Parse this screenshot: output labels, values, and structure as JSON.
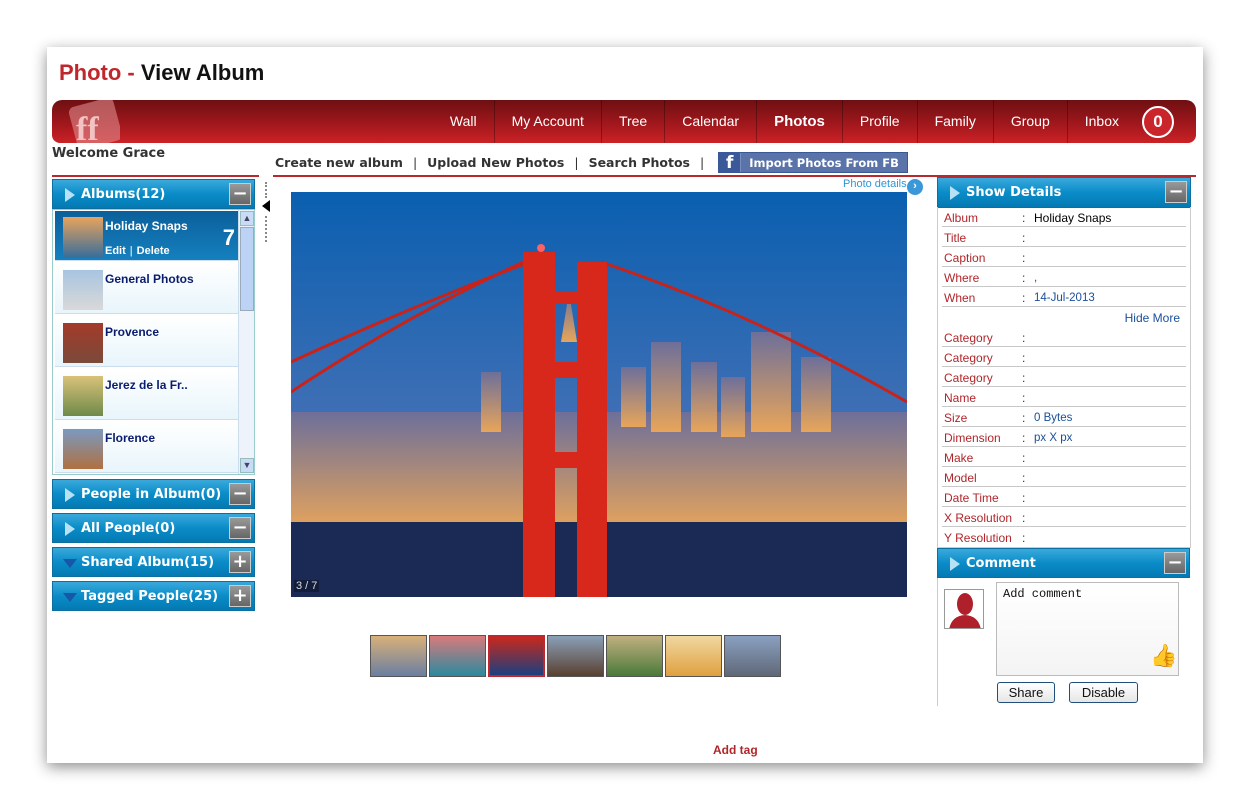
{
  "page": {
    "title_prefix": "Photo -",
    "title": "View Album"
  },
  "nav": {
    "items": [
      "Wall",
      "My Account",
      "Tree",
      "Calendar",
      "Photos",
      "Profile",
      "Family",
      "Group",
      "Inbox"
    ],
    "active": "Photos",
    "inbox_count": "0",
    "brand_color": "#c0272d"
  },
  "welcome": "Welcome Grace",
  "actions": {
    "create": "Create new album",
    "upload": "Upload New Photos",
    "search": "Search Photos",
    "sep": "|",
    "fb": "Import Photos From FB",
    "fb_icon": "f"
  },
  "left": {
    "albums_header": "Albums(12)",
    "albums": [
      {
        "name": "Holiday Snaps",
        "count": "7",
        "edit": "Edit",
        "delete": "Delete",
        "sep": "|"
      },
      {
        "name": "General Photos"
      },
      {
        "name": "Provence"
      },
      {
        "name": "Jerez de la Fr.."
      },
      {
        "name": "Florence"
      }
    ],
    "panels": [
      {
        "label": "People in Album(0)",
        "btn": "−",
        "expanded": true
      },
      {
        "label": "All People(0)",
        "btn": "−",
        "expanded": true
      },
      {
        "label": "Shared Album(15)",
        "btn": "+",
        "expanded": false
      },
      {
        "label": "Tagged People(25)",
        "btn": "+",
        "expanded": false
      }
    ]
  },
  "viewer": {
    "photo_details": "Photo details",
    "counter": "3 / 7",
    "selected_thumb": 3,
    "thumb_count": 7
  },
  "details": {
    "header": "Show Details",
    "btn": "−",
    "hide_more": "Hide More",
    "rows1": [
      {
        "k": "Album",
        "v": "Holiday Snaps"
      },
      {
        "k": "Title",
        "v": ""
      },
      {
        "k": "Caption",
        "v": ""
      },
      {
        "k": "Where",
        "v": ","
      },
      {
        "k": "When",
        "v": "14-Jul-2013"
      }
    ],
    "rows2": [
      {
        "k": "Category",
        "v": ""
      },
      {
        "k": "Category",
        "v": ""
      },
      {
        "k": "Category",
        "v": ""
      },
      {
        "k": "Name",
        "v": ""
      },
      {
        "k": "Size",
        "v": "0 Bytes"
      },
      {
        "k": "Dimension",
        "v": "px X px"
      },
      {
        "k": "Make",
        "v": ""
      },
      {
        "k": "Model",
        "v": ""
      },
      {
        "k": "Date Time",
        "v": ""
      },
      {
        "k": "X Resolution",
        "v": ""
      },
      {
        "k": "Y Resolution",
        "v": ""
      }
    ]
  },
  "comment": {
    "header": "Comment",
    "btn": "−",
    "placeholder": "Add comment",
    "share": "Share",
    "disable": "Disable"
  },
  "add_tag": "Add tag"
}
